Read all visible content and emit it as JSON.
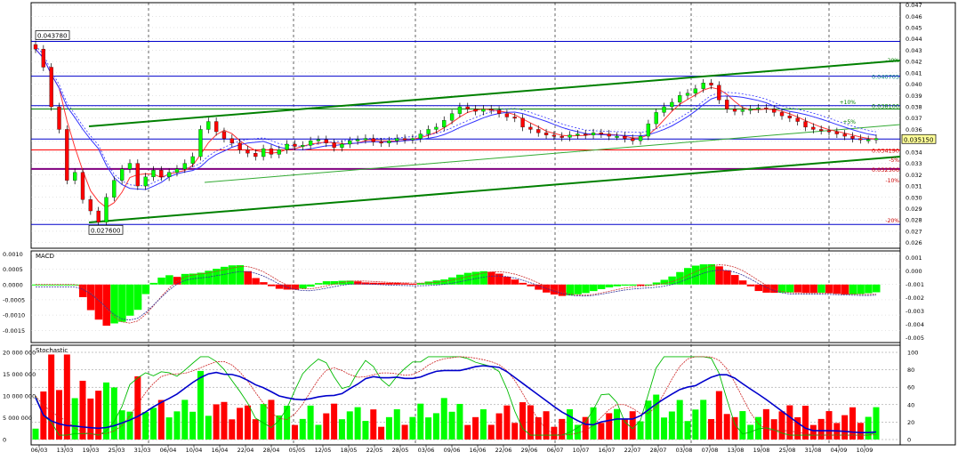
{
  "chart_data": [
    {
      "type": "candlestick",
      "panel": "price",
      "ylim": [
        0.0255,
        0.0472
      ],
      "y_ticks": [
        "0.047",
        "0.046",
        "0.045",
        "0.044",
        "0.043",
        "0.042",
        "0.041",
        "0.040",
        "0.039",
        "0.038",
        "0.037",
        "0.036",
        "0.035",
        "0.034",
        "0.033",
        "0.032",
        "0.031",
        "0.030",
        "0.029",
        "0.028",
        "0.027",
        "0.026"
      ],
      "y_tick_values": [
        0.047,
        0.046,
        0.045,
        0.044,
        0.043,
        0.042,
        0.041,
        0.04,
        0.039,
        0.038,
        0.037,
        0.036,
        0.035,
        0.034,
        0.033,
        0.032,
        0.031,
        0.03,
        0.029,
        0.028,
        0.027,
        0.026
      ],
      "x_labels": [
        "06/03",
        "13/03",
        "19/03",
        "25/03",
        "31/03",
        "06/04",
        "10/04",
        "16/04",
        "22/04",
        "28/04",
        "05/05",
        "12/05",
        "18/05",
        "22/05",
        "28/05",
        "03/06",
        "09/06",
        "16/06",
        "22/06",
        "29/06",
        "06/07",
        "10/07",
        "16/07",
        "22/07",
        "28/07",
        "03/08",
        "07/08",
        "13/08",
        "19/08",
        "25/08",
        "31/08",
        "04/09",
        "10/09"
      ],
      "closes": [
        0.0431,
        0.0415,
        0.038,
        0.036,
        0.0315,
        0.0322,
        0.0298,
        0.0288,
        0.0278,
        0.03,
        0.0315,
        0.0325,
        0.033,
        0.031,
        0.0318,
        0.0324,
        0.0318,
        0.0322,
        0.0325,
        0.033,
        0.0336,
        0.036,
        0.0367,
        0.0358,
        0.0352,
        0.0348,
        0.0342,
        0.0339,
        0.0336,
        0.0343,
        0.0338,
        0.0342,
        0.0347,
        0.0345,
        0.0346,
        0.035,
        0.0351,
        0.0348,
        0.0344,
        0.0347,
        0.035,
        0.0351,
        0.0352,
        0.0349,
        0.0348,
        0.035,
        0.0352,
        0.0351,
        0.0352,
        0.0356,
        0.036,
        0.0362,
        0.0368,
        0.0374,
        0.038,
        0.0378,
        0.0376,
        0.0378,
        0.0377,
        0.0374,
        0.0371,
        0.037,
        0.0362,
        0.036,
        0.0357,
        0.0355,
        0.0354,
        0.0353,
        0.0355,
        0.0356,
        0.0355,
        0.0357,
        0.0356,
        0.0354,
        0.0354,
        0.0352,
        0.035,
        0.0354,
        0.0365,
        0.0375,
        0.038,
        0.0384,
        0.039,
        0.0392,
        0.0396,
        0.0401,
        0.0399,
        0.0386,
        0.0378,
        0.0376,
        0.0377,
        0.0378,
        0.0379,
        0.0378,
        0.0375,
        0.0372,
        0.037,
        0.0367,
        0.0362,
        0.036,
        0.0359,
        0.0358,
        0.0356,
        0.0354,
        0.0352,
        0.0351,
        0.0351,
        0.0352
      ],
      "price_labels": [
        "0.043780",
        "0.040705",
        "0.038100",
        "0.035150",
        "0.034190",
        "0.032506",
        "0.027600"
      ],
      "pct_labels": [
        "-20%",
        "+10%",
        "+5%",
        "-5%",
        "-10%",
        "-20%"
      ]
    },
    {
      "type": "bar",
      "panel": "macd",
      "title": "MACD",
      "ylim": [
        -0.0019,
        0.0011
      ],
      "y_ticks": [
        "0.0010",
        "0.0005",
        "0.0000",
        "-0.0005",
        "-0.0010",
        "-0.0015"
      ],
      "y_tick_values": [
        0.001,
        0.0005,
        0.0,
        -0.0005,
        -0.001,
        -0.0015
      ],
      "right_ticks": [
        "0.001",
        "0.000",
        "-0.001",
        "-0.002",
        "-0.003",
        "-0.004",
        "-0.005"
      ]
    },
    {
      "type": "bar",
      "panel": "stochastic",
      "title": "Stochastic",
      "y_ticks": [
        "20 000 000",
        "15 000 000",
        "10 000 000",
        "5 000 000",
        "0"
      ],
      "y_tick_values": [
        20000000,
        15000000,
        10000000,
        5000000,
        0
      ],
      "right_ticks": [
        "100",
        "80",
        "60",
        "40",
        "20",
        "0"
      ],
      "right_tick_values": [
        100,
        80,
        60,
        40,
        20,
        0
      ]
    }
  ],
  "colors": {
    "up": "#00ff00",
    "down": "#ff0000",
    "trend": "#008000",
    "hline": "#0000cc",
    "support": "#800080",
    "red_line": "#ff0000"
  }
}
